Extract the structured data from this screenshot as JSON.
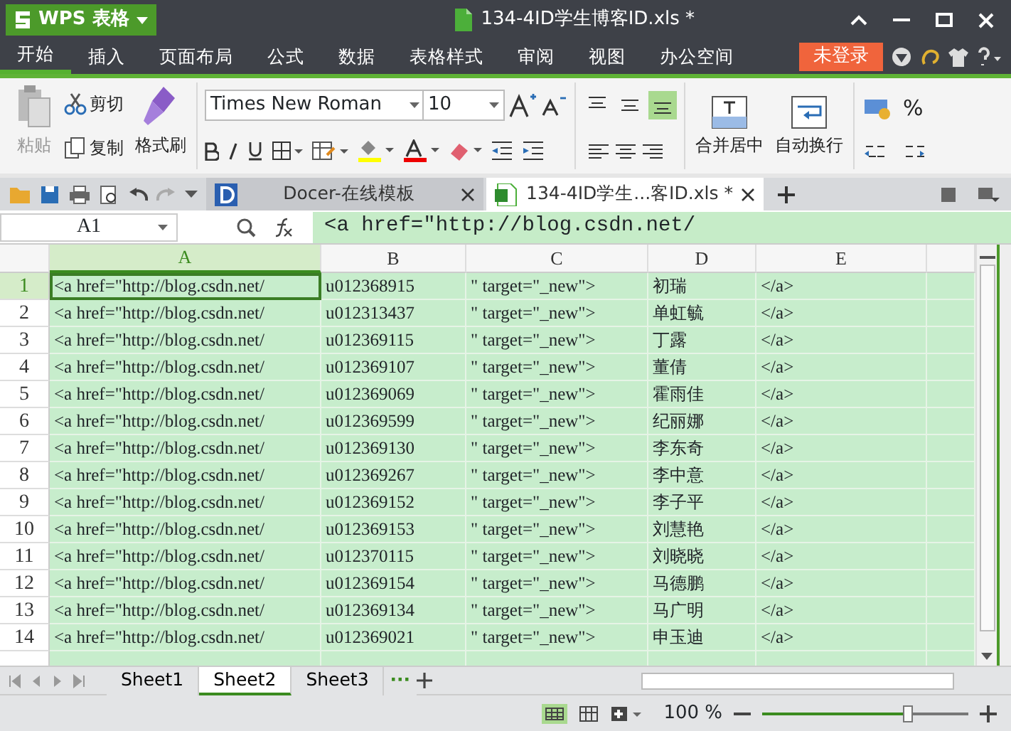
{
  "app": {
    "logo": "WPS 表格",
    "title": "134-4ID学生博客ID.xls *"
  },
  "menu": [
    {
      "label": "开始",
      "selected": true
    },
    {
      "label": "插入",
      "selected": false
    },
    {
      "label": "页面布局",
      "selected": false
    },
    {
      "label": "公式",
      "selected": false
    },
    {
      "label": "数据",
      "selected": false
    },
    {
      "label": "表格样式",
      "selected": false
    },
    {
      "label": "审阅",
      "selected": false
    },
    {
      "label": "视图",
      "selected": false
    },
    {
      "label": "办公空间",
      "selected": false
    }
  ],
  "login": "未登录",
  "ribbon": {
    "paste": "粘贴",
    "cut": "剪切",
    "copy": "复制",
    "format_painter": "格式刷",
    "font": "Times New Roman",
    "size": "10",
    "merge": "合并居中",
    "wrap": "自动换行",
    "percent": "%",
    "valign": [
      {
        "kind": "top",
        "selected": false
      },
      {
        "kind": "middle",
        "selected": false
      },
      {
        "kind": "bottom",
        "selected": true
      }
    ]
  },
  "doc_tabs": [
    {
      "kind": "docer",
      "label": "Docer-在线模板",
      "selected": false
    },
    {
      "kind": "sheet",
      "label": "134-4ID学生...客ID.xls *",
      "selected": true
    }
  ],
  "name_box": "A1",
  "formula": "<a href=\"http://blog.csdn.net/",
  "columns": [
    {
      "label": "A",
      "selected": true
    },
    {
      "label": "B",
      "selected": false
    },
    {
      "label": "C",
      "selected": false
    },
    {
      "label": "D",
      "selected": false
    },
    {
      "label": "E",
      "selected": false
    }
  ],
  "rows": [
    {
      "number": "1",
      "selected": true,
      "cells": [
        "<a href=\"http://blog.csdn.net/",
        "u012368915",
        "\" target=\"_new\">",
        "初瑞",
        "</a>"
      ]
    },
    {
      "number": "2",
      "selected": false,
      "cells": [
        "<a href=\"http://blog.csdn.net/",
        "u012313437",
        "\" target=\"_new\">",
        "单虹毓",
        "</a>"
      ]
    },
    {
      "number": "3",
      "selected": false,
      "cells": [
        "<a href=\"http://blog.csdn.net/",
        "u012369115",
        "\" target=\"_new\">",
        "丁露",
        "</a>"
      ]
    },
    {
      "number": "4",
      "selected": false,
      "cells": [
        "<a href=\"http://blog.csdn.net/",
        "u012369107",
        "\" target=\"_new\">",
        "董倩",
        "</a>"
      ]
    },
    {
      "number": "5",
      "selected": false,
      "cells": [
        "<a href=\"http://blog.csdn.net/",
        "u012369069",
        "\" target=\"_new\">",
        "霍雨佳",
        "</a>"
      ]
    },
    {
      "number": "6",
      "selected": false,
      "cells": [
        "<a href=\"http://blog.csdn.net/",
        "u012369599",
        "\" target=\"_new\">",
        "纪丽娜",
        "</a>"
      ]
    },
    {
      "number": "7",
      "selected": false,
      "cells": [
        "<a href=\"http://blog.csdn.net/",
        "u012369130",
        "\" target=\"_new\">",
        "李东奇",
        "</a>"
      ]
    },
    {
      "number": "8",
      "selected": false,
      "cells": [
        "<a href=\"http://blog.csdn.net/",
        "u012369267",
        "\" target=\"_new\">",
        "李中意",
        "</a>"
      ]
    },
    {
      "number": "9",
      "selected": false,
      "cells": [
        "<a href=\"http://blog.csdn.net/",
        "u012369152",
        "\" target=\"_new\">",
        "李子平",
        "</a>"
      ]
    },
    {
      "number": "10",
      "selected": false,
      "cells": [
        "<a href=\"http://blog.csdn.net/",
        "u012369153",
        "\" target=\"_new\">",
        "刘慧艳",
        "</a>"
      ]
    },
    {
      "number": "11",
      "selected": false,
      "cells": [
        "<a href=\"http://blog.csdn.net/",
        "u012370115",
        "\" target=\"_new\">",
        "刘晓晓",
        "</a>"
      ]
    },
    {
      "number": "12",
      "selected": false,
      "cells": [
        "<a href=\"http://blog.csdn.net/",
        "u012369154",
        "\" target=\"_new\">",
        "马德鹏",
        "</a>"
      ]
    },
    {
      "number": "13",
      "selected": false,
      "cells": [
        "<a href=\"http://blog.csdn.net/",
        "u012369134",
        "\" target=\"_new\">",
        "马广明",
        "</a>"
      ]
    },
    {
      "number": "14",
      "selected": false,
      "cells": [
        "<a href=\"http://blog.csdn.net/",
        "u012369021",
        "\" target=\"_new\">",
        "申玉迪",
        "</a>"
      ]
    }
  ],
  "sheets": [
    {
      "label": "Sheet1",
      "selected": false
    },
    {
      "label": "Sheet2",
      "selected": true
    },
    {
      "label": "Sheet3",
      "selected": false
    }
  ],
  "sheet_more": "···",
  "zoom": {
    "reading": "100 %",
    "level": 0.7
  }
}
